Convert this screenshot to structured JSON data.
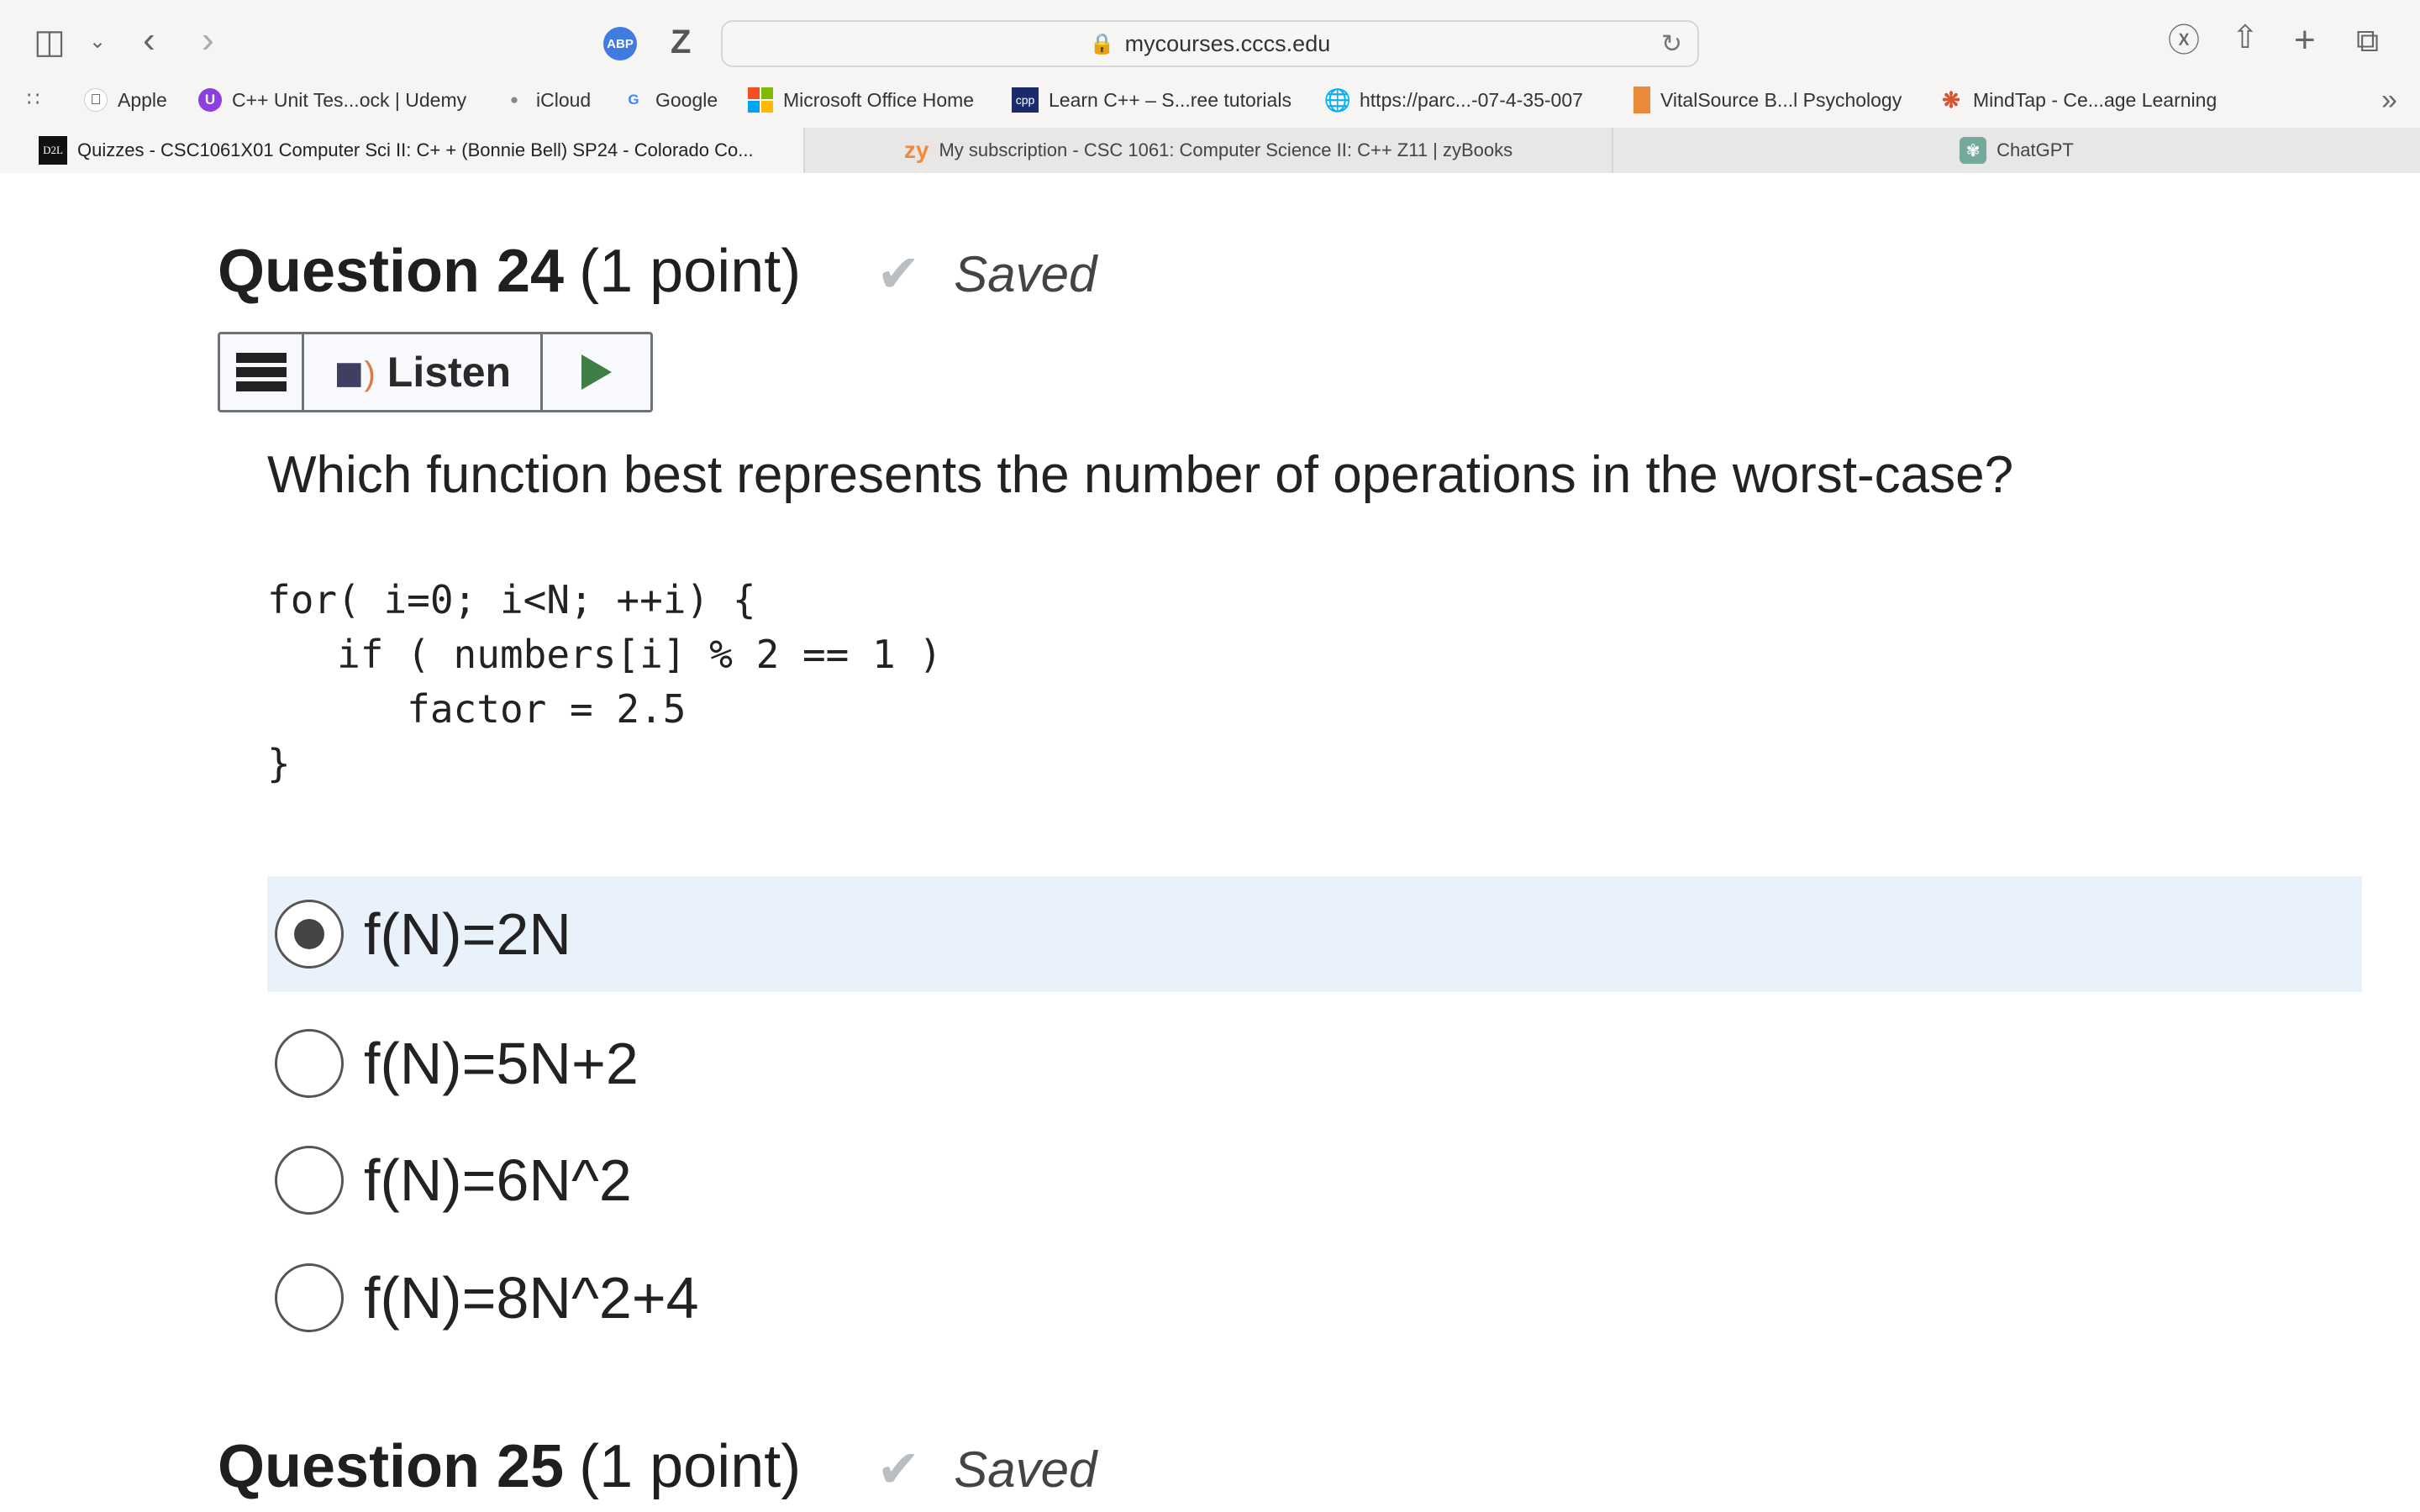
{
  "browser": {
    "url": "mycourses.cccs.edu",
    "extension_abp": "ABP",
    "extension_z": "Z",
    "bookmarks": [
      {
        "label": "Apple",
        "icon": "apple-icon"
      },
      {
        "label": "C++ Unit Tes...ock | Udemy",
        "icon": "udemy-icon"
      },
      {
        "label": "iCloud",
        "icon": "apple-icon"
      },
      {
        "label": "Google",
        "icon": "google-icon"
      },
      {
        "label": "Microsoft Office Home",
        "icon": "microsoft-icon"
      },
      {
        "label": "Learn C++ – S...ree tutorials",
        "icon": "cpp-icon"
      },
      {
        "label": "https://parc...-07-4-35-007",
        "icon": "globe-icon"
      },
      {
        "label": "VitalSource B...l Psychology",
        "icon": "vitalsource-icon"
      },
      {
        "label": "MindTap - Ce...age Learning",
        "icon": "mindtap-icon"
      }
    ],
    "tabs": [
      {
        "label": "Quizzes - CSC1061X01 Computer Sci II: C+ + (Bonnie Bell) SP24 - Colorado Co...",
        "icon_text": "D2L",
        "active": true
      },
      {
        "label": "My subscription - CSC 1061: Computer Science II: C++ Z11 | zyBooks",
        "icon_text": "zy",
        "active": false
      },
      {
        "label": "ChatGPT",
        "icon_text": "",
        "active": false
      }
    ]
  },
  "question24": {
    "title": "Question 24",
    "points": "(1 point)",
    "status": "Saved",
    "listen_label": "Listen",
    "prompt": "Which function best represents the number of operations in the worst-case?",
    "code": [
      "for( i=0; i<N; ++i) {",
      "   if ( numbers[i] % 2 == 1 )",
      "      factor = 2.5",
      "}"
    ],
    "options": [
      {
        "label": "f(N)=2N",
        "selected": true
      },
      {
        "label": "f(N)=5N+2",
        "selected": false
      },
      {
        "label": "f(N)=6N^2",
        "selected": false
      },
      {
        "label": "f(N)=8N^2+4",
        "selected": false
      }
    ]
  },
  "question25": {
    "title": "Question 25",
    "points": "(1 point)",
    "status": "Saved"
  },
  "colors": {
    "selected_bg": "#e9f1fb",
    "play_green": "#3f7f47",
    "speaker_orange": "#e07b3f"
  }
}
